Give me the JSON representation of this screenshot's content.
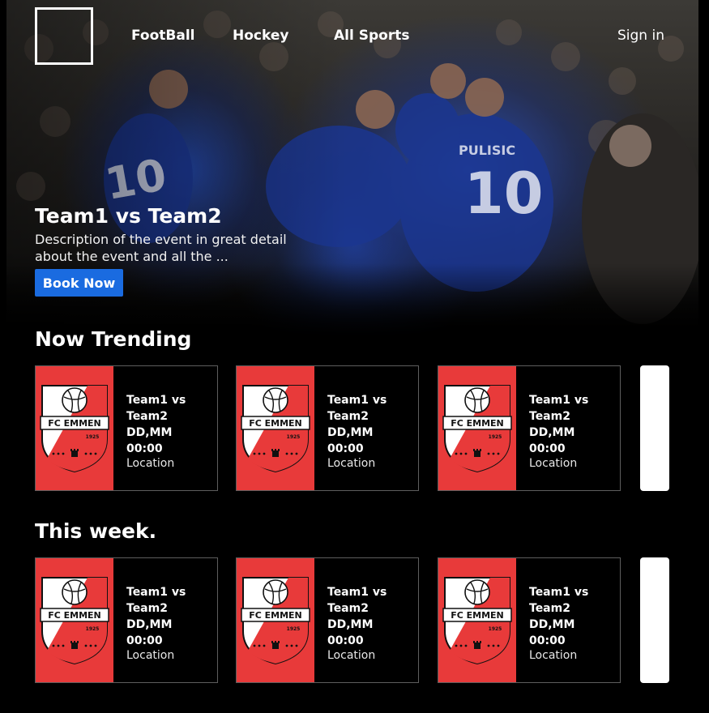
{
  "nav": {
    "links": [
      "FootBall",
      "Hockey",
      "All Sports"
    ],
    "sign_in": "Sign in"
  },
  "hero": {
    "jersey_left": "10",
    "jersey_right_name": "PULISIC",
    "jersey_right_number": "10",
    "title": "Team1 vs Team2",
    "description": "Description of the event in great detail about the event and all the ...",
    "book_label": "Book Now"
  },
  "badge": {
    "name": "FC EMMEN",
    "year": "1925"
  },
  "trending": {
    "title": "Now Trending",
    "cards": [
      {
        "teams": "Team1 vs Team2",
        "date": "DD,MM",
        "time": "00:00",
        "location": "Location"
      },
      {
        "teams": "Team1 vs Team2",
        "date": "DD,MM",
        "time": "00:00",
        "location": "Location"
      },
      {
        "teams": "Team1 vs Team2",
        "date": "DD,MM",
        "time": "00:00",
        "location": "Location"
      }
    ]
  },
  "this_week": {
    "title": "This week.",
    "cards": [
      {
        "teams": "Team1 vs Team2",
        "date": "DD,MM",
        "time": "00:00",
        "location": "Location"
      },
      {
        "teams": "Team1 vs Team2",
        "date": "DD,MM",
        "time": "00:00",
        "location": "Location"
      },
      {
        "teams": "Team1 vs Team2",
        "date": "DD,MM",
        "time": "00:00",
        "location": "Location"
      }
    ]
  },
  "colors": {
    "accent_button": "#1a6be0",
    "badge_red": "#e83a3a"
  }
}
